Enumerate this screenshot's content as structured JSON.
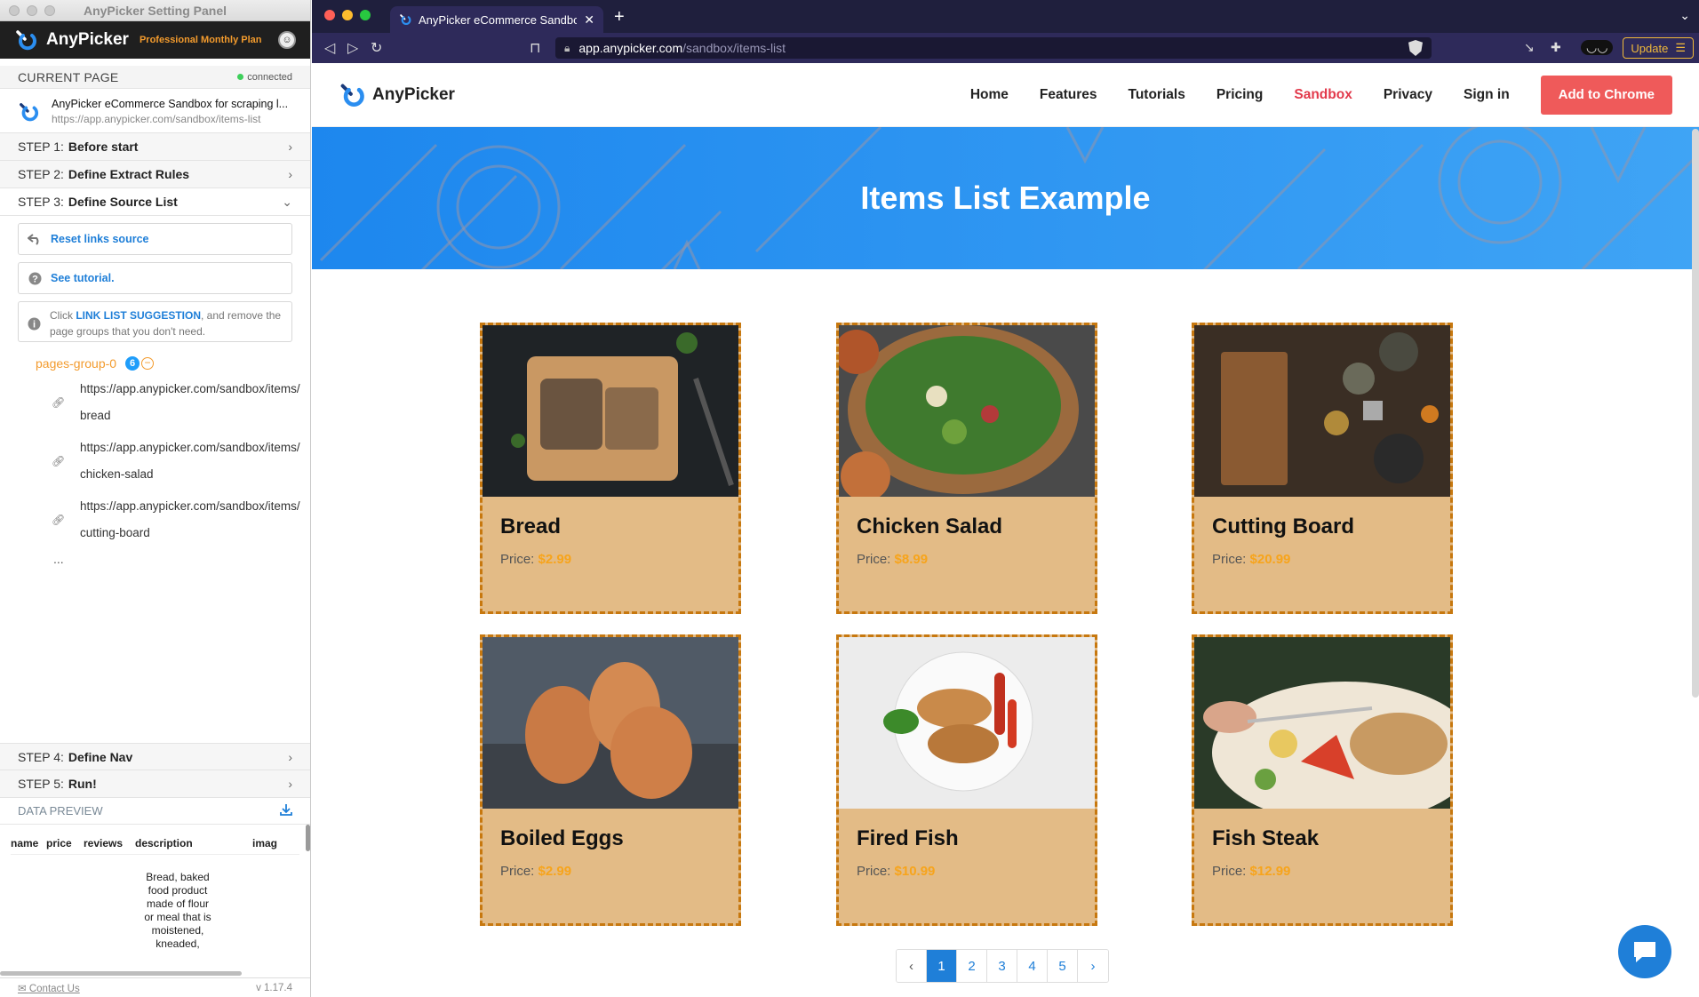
{
  "panel": {
    "window_title": "AnyPicker Setting Panel",
    "brand": "AnyPicker",
    "plan": "Professional Monthly Plan",
    "current_page_label": "CURRENT PAGE",
    "connection_status": "connected",
    "page_title": "AnyPicker eCommerce Sandbox for scraping l...",
    "page_url": "https://app.anypicker.com/sandbox/items-list",
    "steps": [
      {
        "num": "STEP 1:",
        "title": "Before start"
      },
      {
        "num": "STEP 2:",
        "title": "Define Extract Rules"
      },
      {
        "num": "STEP 3:",
        "title": "Define Source List"
      },
      {
        "num": "STEP 4:",
        "title": "Define Nav"
      },
      {
        "num": "STEP 5:",
        "title": "Run!"
      }
    ],
    "reset_links": "Reset links source",
    "see_tutorial": "See tutorial.",
    "hint_pre": "Click ",
    "hint_link": "LINK LIST SUGGESTION",
    "hint_post": ", and remove the page groups that you don't need.",
    "group_name": "pages-group-0",
    "group_count": "6",
    "links": [
      "https://app.anypicker.com/sandbox/items/bread",
      "https://app.anypicker.com/sandbox/items/chicken-salad",
      "https://app.anypicker.com/sandbox/items/cutting-board"
    ],
    "more": "...",
    "data_preview_label": "DATA PREVIEW",
    "columns": [
      "name",
      "price",
      "reviews",
      "description",
      "imag"
    ],
    "description_preview": "Bread, baked food product made of flour or meal that is moistened, kneaded,",
    "contact": "Contact Us",
    "version": "v 1.17.4"
  },
  "browser": {
    "tab_title": "AnyPicker eCommerce Sandbox",
    "url_domain": "app.anypicker.com",
    "url_path": "/sandbox/items-list",
    "update_label": "Update"
  },
  "site": {
    "brand": "AnyPicker",
    "nav": [
      "Home",
      "Features",
      "Tutorials",
      "Pricing",
      "Sandbox",
      "Privacy",
      "Sign in"
    ],
    "cta": "Add to Chrome",
    "hero_title": "Items List Example",
    "price_label": "Price:",
    "items": [
      {
        "name": "Bread",
        "price": "$2.99"
      },
      {
        "name": "Chicken Salad",
        "price": "$8.99"
      },
      {
        "name": "Cutting Board",
        "price": "$20.99"
      },
      {
        "name": "Boiled Eggs",
        "price": "$2.99"
      },
      {
        "name": "Fired Fish",
        "price": "$10.99"
      },
      {
        "name": "Fish Steak",
        "price": "$12.99"
      }
    ],
    "pages": [
      "1",
      "2",
      "3",
      "4",
      "5"
    ],
    "accent": "#1f7fd8",
    "card_bg": "#e3bb86",
    "price_color": "#f7a41b"
  }
}
